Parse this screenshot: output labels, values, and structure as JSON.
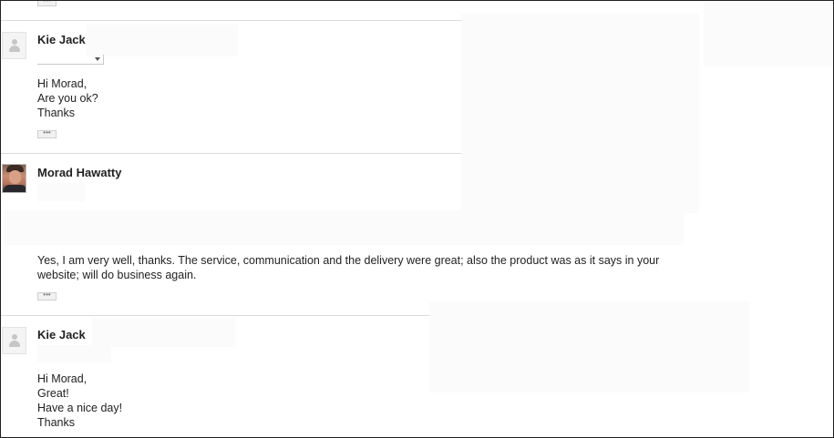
{
  "thread": {
    "messages": [
      {
        "sender": "Kie Jack",
        "body_lines": [
          "Hi Morad,",
          "Are you ok?",
          "Thanks"
        ],
        "more_label": "•••"
      },
      {
        "sender": "Morad Hawatty",
        "body": "Yes, I am very well, thanks. The service, communication and the delivery were great; also the product was as it says in your website; will do business again.",
        "more_label": "•••"
      },
      {
        "sender": "Kie Jack",
        "body_lines": [
          "Hi Morad,",
          "Great!",
          "Have a nice day!",
          "Thanks"
        ]
      }
    ],
    "top_more_label": "•••"
  },
  "colors": {
    "redaction": "#fcfbfc",
    "divider": "#dcdcdc",
    "text": "#222222"
  },
  "icons": {
    "default_avatar": "person-silhouette-icon",
    "caret": "caret-down-icon"
  }
}
